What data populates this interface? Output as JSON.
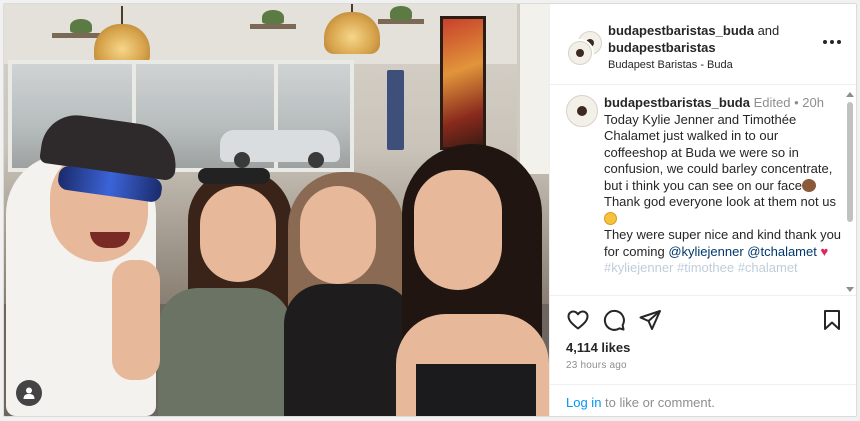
{
  "post": {
    "author": "budapestbaristas_buda",
    "conjunction": "and",
    "collaborator": "budapestbaristas",
    "location": "Budapest Baristas - Buda",
    "caption": {
      "username": "budapestbaristas_buda",
      "edited": "Edited",
      "separator": "•",
      "age": "20h",
      "line1": "Today Kylie Jenner and Timothée Chalamet just walked in to our coffeeshop at Buda we were so in confusion, we could barley concentrate, but i think you can see on our face",
      "line2": "Thank god everyone look at them not us",
      "line3": "They were super nice and kind thank you for coming",
      "mention1": "@kyliejenner",
      "mention2": "@tchalamet",
      "hashtags": "#kyliejenner #timothee #chalamet"
    },
    "likes": "4,114 likes",
    "time": "23 hours ago",
    "login_link": "Log in",
    "login_rest": "to like or comment."
  },
  "icons": {
    "more": "more-options-icon",
    "like": "heart-icon",
    "comment": "comment-icon",
    "share": "share-icon",
    "save": "bookmark-icon",
    "tag": "user-tag-icon"
  },
  "colors": {
    "link": "#00376b",
    "login": "#0095f6",
    "text": "#262626",
    "muted": "#8e8e8e"
  }
}
